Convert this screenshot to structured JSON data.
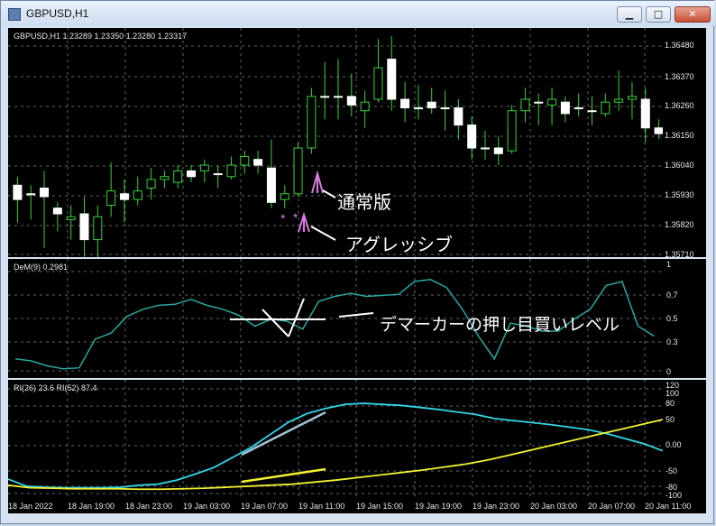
{
  "window": {
    "title": "GBPUSD,H1"
  },
  "chart": {
    "symbol_info": "GBPUSD,H1  1.23289 1.23350 1.23280 1.23317",
    "price_ticks": [
      "1.36480",
      "1.36370",
      "1.36260",
      "1.36150",
      "1.36040",
      "1.35930",
      "1.35820",
      "1.35710"
    ],
    "annotations": {
      "standard": "通常版",
      "aggressive": "アグレッシブ",
      "pullback": "デマーカーの押し目買いレベル"
    }
  },
  "dem": {
    "title": "DeM(9) 0.2981",
    "ticks": [
      "1",
      "0.7",
      "0.5",
      "0.3",
      "0"
    ],
    "values": [
      0.12,
      0.1,
      0.05,
      0.02,
      0.03,
      0.32,
      0.38,
      0.55,
      0.62,
      0.66,
      0.67,
      0.72,
      0.66,
      0.62,
      0.56,
      0.45,
      0.52,
      0.5,
      0.42,
      0.7,
      0.75,
      0.78,
      0.75,
      0.76,
      0.77,
      0.9,
      0.92,
      0.84,
      0.62,
      0.35,
      0.12,
      0.48,
      0.45,
      0.4,
      0.4,
      0.52,
      0.62,
      0.86,
      0.9,
      0.45,
      0.35
    ]
  },
  "rci": {
    "title": "RI(26) 23.6  RI(52) 87.4",
    "ticks": [
      "120",
      "100",
      "80",
      "50",
      "0.00",
      "-50",
      "-80",
      "-100"
    ],
    "ri26": [
      -68,
      -82,
      -84,
      -85,
      -85,
      -85,
      -84,
      -80,
      -78,
      -70,
      -58,
      -45,
      -25,
      -5,
      20,
      45,
      62,
      72,
      80,
      82,
      80,
      78,
      74,
      70,
      65,
      60,
      52,
      48,
      44,
      40,
      35,
      30,
      22,
      12,
      2,
      -12
    ],
    "ri52": [
      -80,
      -85,
      -86,
      -87,
      -87,
      -87,
      -88,
      -88,
      -87,
      -86,
      -84,
      -82,
      -80,
      -78,
      -74,
      -70,
      -65,
      -60,
      -55,
      -50,
      -44,
      -38,
      -30,
      -20,
      -10,
      0,
      10,
      20,
      30,
      40,
      50
    ]
  },
  "x_ticks": [
    "18 Jan 2022",
    "18 Jan 19:00",
    "18 Jan 23:00",
    "19 Jan 03:00",
    "19 Jan 07:00",
    "19 Jan 11:00",
    "19 Jan 15:00",
    "19 Jan 19:00",
    "19 Jan 23:00",
    "20 Jan 03:00",
    "20 Jan 07:00",
    "20 Jan 11:00"
  ],
  "candles": [
    {
      "o": 1.3597,
      "c": 1.3592,
      "h": 1.36,
      "l": 1.3584
    },
    {
      "o": 1.3594,
      "c": 1.3594,
      "h": 1.3597,
      "l": 1.3585
    },
    {
      "o": 1.3596,
      "c": 1.3593,
      "h": 1.3602,
      "l": 1.3575
    },
    {
      "o": 1.3589,
      "c": 1.3587,
      "h": 1.3591,
      "l": 1.3581
    },
    {
      "o": 1.3585,
      "c": 1.3586,
      "h": 1.359,
      "l": 1.3578
    },
    {
      "o": 1.3587,
      "c": 1.3578,
      "h": 1.3593,
      "l": 1.3572
    },
    {
      "o": 1.3578,
      "c": 1.3586,
      "h": 1.359,
      "l": 1.3571
    },
    {
      "o": 1.359,
      "c": 1.3595,
      "h": 1.3605,
      "l": 1.3586
    },
    {
      "o": 1.3594,
      "c": 1.3592,
      "h": 1.3599,
      "l": 1.3584
    },
    {
      "o": 1.3592,
      "c": 1.3595,
      "h": 1.36,
      "l": 1.359
    },
    {
      "o": 1.3596,
      "c": 1.3599,
      "h": 1.3603,
      "l": 1.3592
    },
    {
      "o": 1.3599,
      "c": 1.36,
      "h": 1.3602,
      "l": 1.3596
    },
    {
      "o": 1.3598,
      "c": 1.3602,
      "h": 1.3604,
      "l": 1.3596
    },
    {
      "o": 1.3602,
      "c": 1.36,
      "h": 1.3604,
      "l": 1.3598
    },
    {
      "o": 1.3602,
      "c": 1.3604,
      "h": 1.3606,
      "l": 1.3598
    },
    {
      "o": 1.3601,
      "c": 1.3601,
      "h": 1.3604,
      "l": 1.3596
    },
    {
      "o": 1.36,
      "c": 1.3604,
      "h": 1.3607,
      "l": 1.3599
    },
    {
      "o": 1.3604,
      "c": 1.3607,
      "h": 1.3609,
      "l": 1.3601
    },
    {
      "o": 1.3606,
      "c": 1.3604,
      "h": 1.3609,
      "l": 1.3601
    },
    {
      "o": 1.3603,
      "c": 1.3591,
      "h": 1.3613,
      "l": 1.3589
    },
    {
      "o": 1.3592,
      "c": 1.3594,
      "h": 1.3597,
      "l": 1.3589
    },
    {
      "o": 1.3594,
      "c": 1.361,
      "h": 1.3612,
      "l": 1.3593
    },
    {
      "o": 1.361,
      "c": 1.3628,
      "h": 1.3631,
      "l": 1.3608
    },
    {
      "o": 1.3628,
      "c": 1.3628,
      "h": 1.364,
      "l": 1.362
    },
    {
      "o": 1.3628,
      "c": 1.3628,
      "h": 1.3641,
      "l": 1.362
    },
    {
      "o": 1.3628,
      "c": 1.3625,
      "h": 1.3636,
      "l": 1.3621
    },
    {
      "o": 1.3623,
      "c": 1.3626,
      "h": 1.363,
      "l": 1.3617
    },
    {
      "o": 1.3627,
      "c": 1.3638,
      "h": 1.3648,
      "l": 1.3626
    },
    {
      "o": 1.3641,
      "c": 1.3627,
      "h": 1.3649,
      "l": 1.3623
    },
    {
      "o": 1.3627,
      "c": 1.3624,
      "h": 1.3633,
      "l": 1.3619
    },
    {
      "o": 1.3624,
      "c": 1.3624,
      "h": 1.3632,
      "l": 1.362
    },
    {
      "o": 1.3626,
      "c": 1.3624,
      "h": 1.3631,
      "l": 1.3622
    },
    {
      "o": 1.3624,
      "c": 1.3624,
      "h": 1.363,
      "l": 1.3616
    },
    {
      "o": 1.3624,
      "c": 1.3618,
      "h": 1.3627,
      "l": 1.3613
    },
    {
      "o": 1.3618,
      "c": 1.361,
      "h": 1.3621,
      "l": 1.3606
    },
    {
      "o": 1.361,
      "c": 1.361,
      "h": 1.3616,
      "l": 1.3606
    },
    {
      "o": 1.361,
      "c": 1.3608,
      "h": 1.3614,
      "l": 1.3604
    },
    {
      "o": 1.3609,
      "c": 1.3623,
      "h": 1.3625,
      "l": 1.3608
    },
    {
      "o": 1.3623,
      "c": 1.3627,
      "h": 1.3631,
      "l": 1.3619
    },
    {
      "o": 1.3626,
      "c": 1.3626,
      "h": 1.3629,
      "l": 1.3618
    },
    {
      "o": 1.3625,
      "c": 1.3627,
      "h": 1.3631,
      "l": 1.3618
    },
    {
      "o": 1.3626,
      "c": 1.3622,
      "h": 1.3628,
      "l": 1.3619
    },
    {
      "o": 1.3624,
      "c": 1.3624,
      "h": 1.3629,
      "l": 1.3621
    },
    {
      "o": 1.3623,
      "c": 1.3623,
      "h": 1.3628,
      "l": 1.3618
    },
    {
      "o": 1.3622,
      "c": 1.3626,
      "h": 1.3629,
      "l": 1.3621
    },
    {
      "o": 1.3626,
      "c": 1.3627,
      "h": 1.3637,
      "l": 1.3623
    },
    {
      "o": 1.3627,
      "c": 1.3628,
      "h": 1.3633,
      "l": 1.362
    },
    {
      "o": 1.3627,
      "c": 1.3617,
      "h": 1.3631,
      "l": 1.3612
    },
    {
      "o": 1.3617,
      "c": 1.3615,
      "h": 1.362,
      "l": 1.3613
    }
  ]
}
